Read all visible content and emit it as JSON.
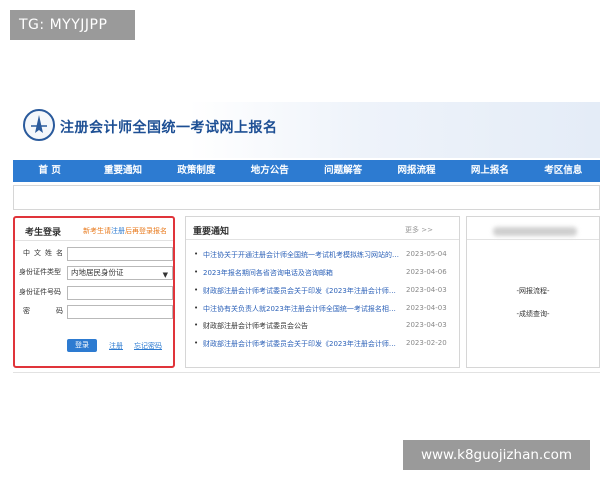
{
  "watermarks": {
    "top_left": "TG: MYYJJPP",
    "bottom_right": "www.k8guojizhan.com"
  },
  "site": {
    "title": "注册会计师全国统一考试网上报名"
  },
  "nav": [
    {
      "label": "首 页"
    },
    {
      "label": "重要通知"
    },
    {
      "label": "政策制度"
    },
    {
      "label": "地方公告"
    },
    {
      "label": "问题解答"
    },
    {
      "label": "网报流程"
    },
    {
      "label": "网上报名"
    },
    {
      "label": "考区信息"
    }
  ],
  "login": {
    "title": "考生登录",
    "hint_a": "新考生请",
    "hint_b": "注册",
    "hint_c": "后再登录报名",
    "fields": {
      "name_label_a": "中",
      "name_label_b": "文",
      "name_label_c": "姓",
      "name_label_d": "名",
      "name_value": "",
      "idtype_label": "身份证件类型",
      "idtype_value": "内地居民身份证",
      "idnum_label": "身份证件号码",
      "idnum_value": "",
      "password_label_a": "密",
      "password_label_b": "码",
      "password_value": ""
    },
    "login_button": "登录",
    "register_link": "注册",
    "forgot_link": "忘记密码"
  },
  "news": {
    "title": "重要通知",
    "more": "更多 >>",
    "items": [
      {
        "text": "中注协关于开通注册会计师全国统一考试机考模拟练习网站的公…",
        "date": "2023-05-04"
      },
      {
        "text": "2023年报名期间各省咨询电话及咨询邮箱",
        "date": "2023-04-06"
      },
      {
        "text": "财政部注册会计师考试委员会关于印发《2023年注册会计师…",
        "date": "2023-04-03"
      },
      {
        "text": "中注协有关负责人就2023年注册会计师全国统一考试报名相…",
        "date": "2023-04-03"
      },
      {
        "text": "财政部注册会计师考试委员会公告",
        "date": "2023-04-03"
      },
      {
        "text": "财政部注册会计师考试委员会关于印发《2023年注册会计师…",
        "date": "2023-02-20"
      }
    ]
  },
  "side": {
    "link1": "-网报流程-",
    "link2": "-成绩查询-"
  },
  "colors": {
    "nav_bg": "#2d7bd1",
    "highlight_border": "#e0343a",
    "brand_blue": "#1d4f94"
  }
}
